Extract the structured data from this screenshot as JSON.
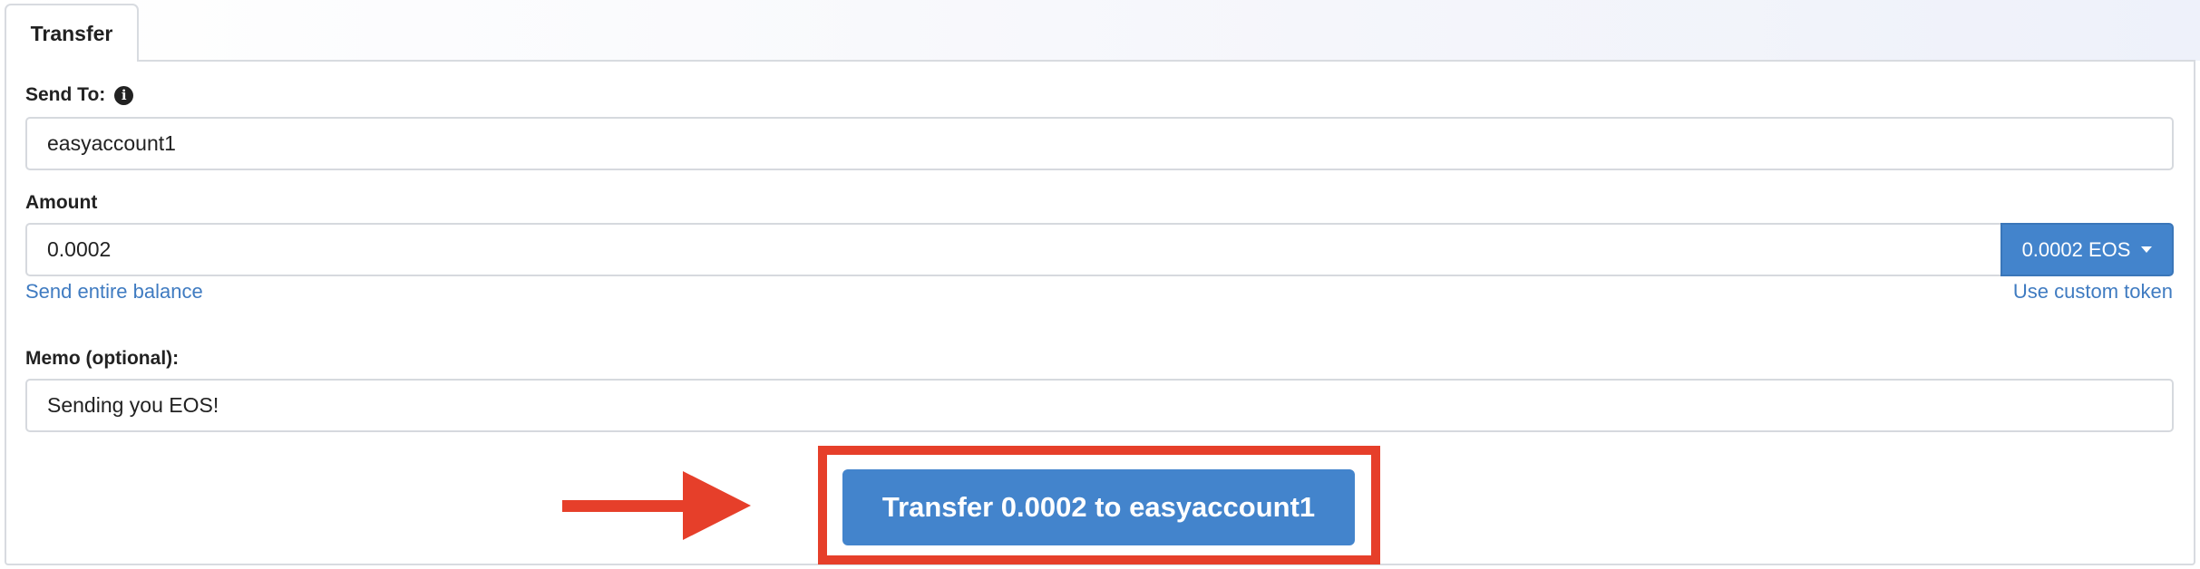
{
  "tabs": [
    {
      "label": "Transfer",
      "active": true
    }
  ],
  "send_to": {
    "label": "Send To:",
    "info_icon": "info-circle-icon",
    "value": "easyaccount1"
  },
  "amount": {
    "label": "Amount",
    "value": "0.0002",
    "token_selector": "0.0002 EOS",
    "send_entire_balance_link": "Send entire balance",
    "custom_token_link": "Use custom token"
  },
  "memo": {
    "label": "Memo (optional):",
    "value": "Sending you EOS!"
  },
  "submit": {
    "label": "Transfer 0.0002 to easyaccount1"
  },
  "annotation": {
    "arrow_icon": "right-arrow-icon",
    "color": "#e63f2a"
  },
  "colors": {
    "primary": "#4384cc",
    "link": "#3f7bc1",
    "border": "#d6d9de"
  }
}
